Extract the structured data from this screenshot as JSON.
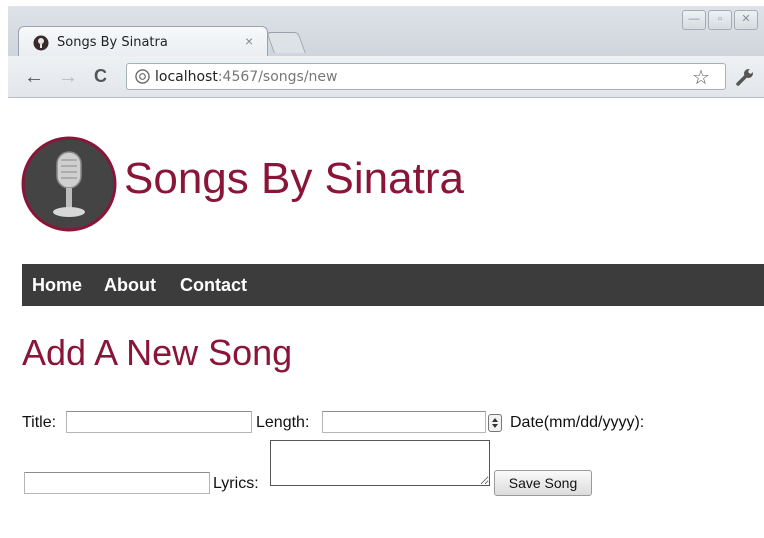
{
  "browser": {
    "tab_title": "Songs By Sinatra",
    "tab_close": "×",
    "url_host": "localhost",
    "url_rest": ":4567/songs/new",
    "back_icon": "←",
    "forward_icon": "→",
    "reload_icon": "C",
    "bookmark_icon": "☆"
  },
  "site": {
    "title": "Songs By Sinatra",
    "nav": [
      "Home",
      "About",
      "Contact"
    ],
    "accent_color": "#8a1538",
    "nav_bg": "#3c3c3c"
  },
  "form": {
    "heading": "Add A New Song",
    "title_label": "Title:",
    "length_label": "Length:",
    "date_label": "Date(mm/dd/yyyy):",
    "lyrics_label": "Lyrics:",
    "title_value": "",
    "length_value": "",
    "date_value": "",
    "lyrics_value": "",
    "submit_label": "Save Song"
  }
}
